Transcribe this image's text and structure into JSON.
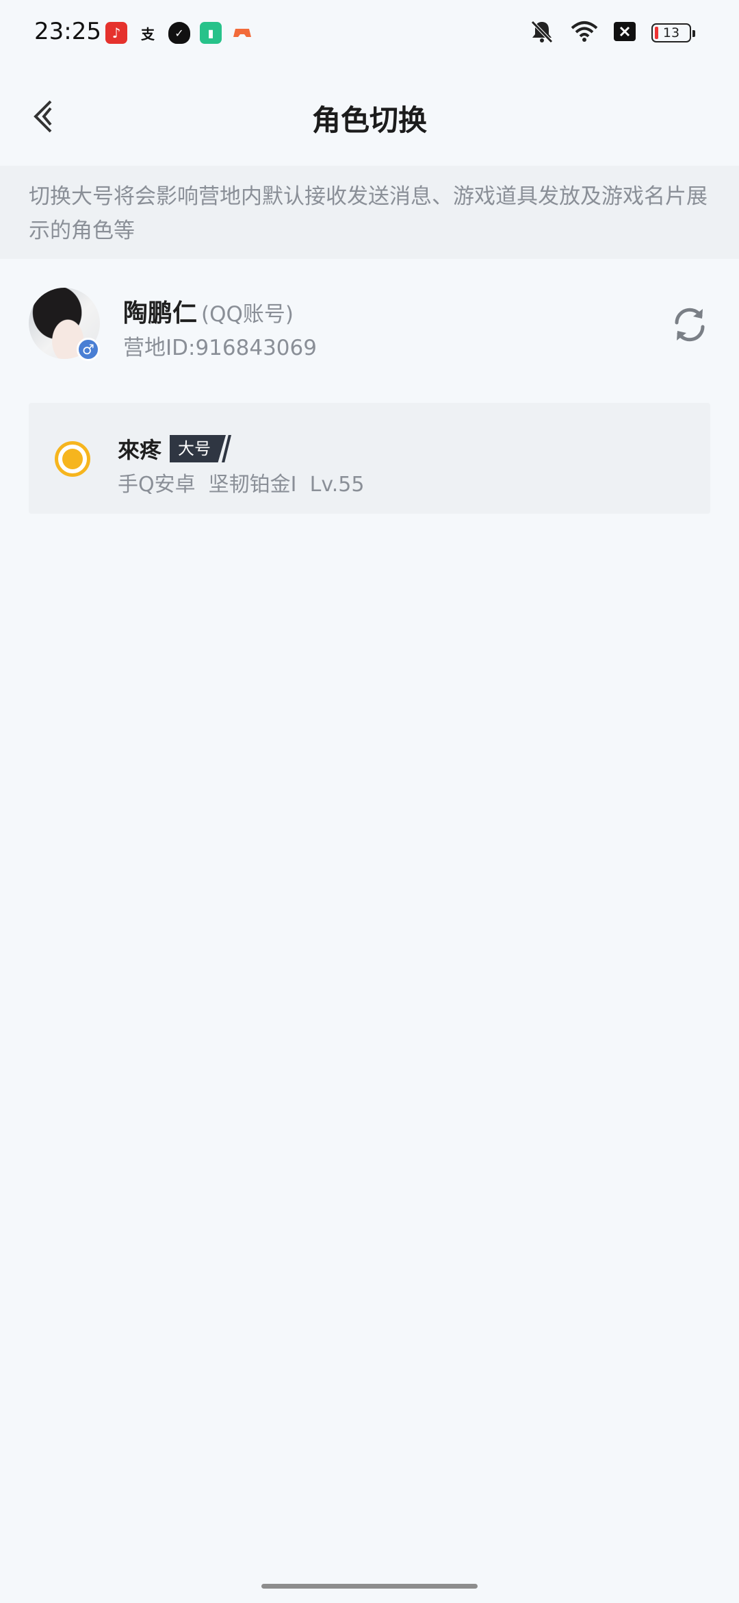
{
  "status_bar": {
    "time": "23:25",
    "notification_icons": [
      "music-app-icon",
      "alipay-icon",
      "shield-app-icon",
      "battery-app-icon",
      "game-app-icon"
    ],
    "system_icons": [
      "mute-icon",
      "wifi-icon",
      "close-box-icon"
    ],
    "battery_level": "13"
  },
  "header": {
    "title": "角色切换"
  },
  "notice": {
    "text": "切换大号将会影响营地内默认接收发送消息、游戏道具发放及游戏名片展示的角色等"
  },
  "account": {
    "name": "陶鹏仁",
    "type": "(QQ账号)",
    "id_text": "营地ID:916843069",
    "gender_symbol": "♂"
  },
  "roles": [
    {
      "name": "來疼",
      "badge": "大号",
      "detail": "手Q安卓  坚韧铂金I  Lv.55",
      "selected": true
    }
  ],
  "colors": {
    "background": "#f5f8fb",
    "accent_yellow": "#f6b51e",
    "gender_blue": "#4a7fd4",
    "badge_dark": "#2f3642"
  }
}
